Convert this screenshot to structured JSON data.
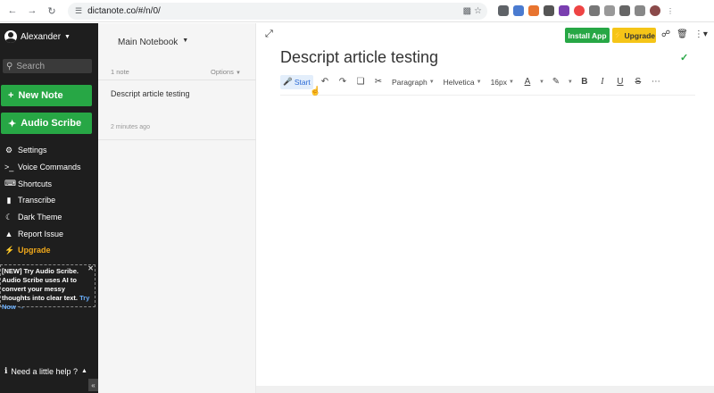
{
  "browser": {
    "url": "dictanote.co/#/n/0/"
  },
  "sidebar": {
    "user_name": "Alexander",
    "search_placeholder": "Search",
    "new_note_label": "New Note",
    "audio_scribe_label": "Audio Scribe",
    "menu": [
      {
        "label": "Settings",
        "icon": "gear-icon"
      },
      {
        "label": "Voice Commands",
        "icon": "terminal-icon"
      },
      {
        "label": "Shortcuts",
        "icon": "keyboard-icon"
      },
      {
        "label": "Transcribe",
        "icon": "file-icon"
      },
      {
        "label": "Dark Theme",
        "icon": "moon-icon"
      },
      {
        "label": "Report Issue",
        "icon": "warning-icon"
      },
      {
        "label": "Upgrade",
        "icon": "bolt-icon"
      }
    ],
    "promo": {
      "prefix": "[NEW] Try Audio Scribe.",
      "body": "Audio Scribe uses AI to convert your messy thoughts into clear text.",
      "link": "Try Now →"
    },
    "help_label": "Need a little help ?",
    "accent_color": "#27a745",
    "upgrade_color": "#f0a81a"
  },
  "notes_list": {
    "notebook_name": "Main Notebook",
    "count_label": "1 note",
    "options_label": "Options",
    "notes": [
      {
        "title": "Descript article testing",
        "time": "2 minutes ago"
      }
    ]
  },
  "editor": {
    "install_label": "Install App",
    "upgrade_label": "Upgrade",
    "title": "Descript article testing",
    "toolbar": {
      "start_label": "Start",
      "block_format": "Paragraph",
      "font": "Helvetica",
      "size": "16px"
    }
  }
}
